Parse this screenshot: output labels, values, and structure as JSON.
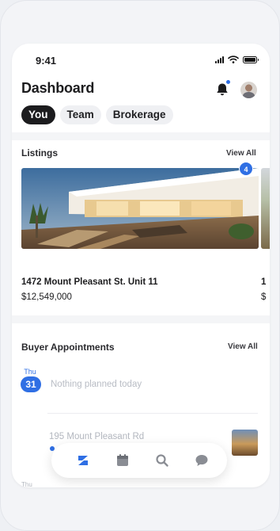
{
  "status_bar": {
    "time": "9:41"
  },
  "header": {
    "title": "Dashboard"
  },
  "tabs": [
    {
      "label": "You",
      "active": true
    },
    {
      "label": "Team",
      "active": false
    },
    {
      "label": "Brokerage",
      "active": false
    }
  ],
  "listings": {
    "title": "Listings",
    "view_all": "View All",
    "count": "4",
    "items": [
      {
        "address": "1472 Mount Pleasant St. Unit 11",
        "price": "$12,549,000"
      },
      {
        "address": "1",
        "price": "$"
      }
    ]
  },
  "appointments": {
    "title": "Buyer Appointments",
    "view_all": "View All",
    "day": "Thu",
    "date": "31",
    "empty_message": "Nothing planned today",
    "next_address": "195 Mount Pleasant Rd",
    "next_day": "Thu"
  },
  "nav": {
    "items": [
      "dashboard-icon",
      "calendar-icon",
      "search-icon",
      "chat-icon"
    ],
    "active": "dashboard-icon"
  },
  "colors": {
    "accent": "#2f6fe4",
    "dark": "#1c1c1e"
  }
}
